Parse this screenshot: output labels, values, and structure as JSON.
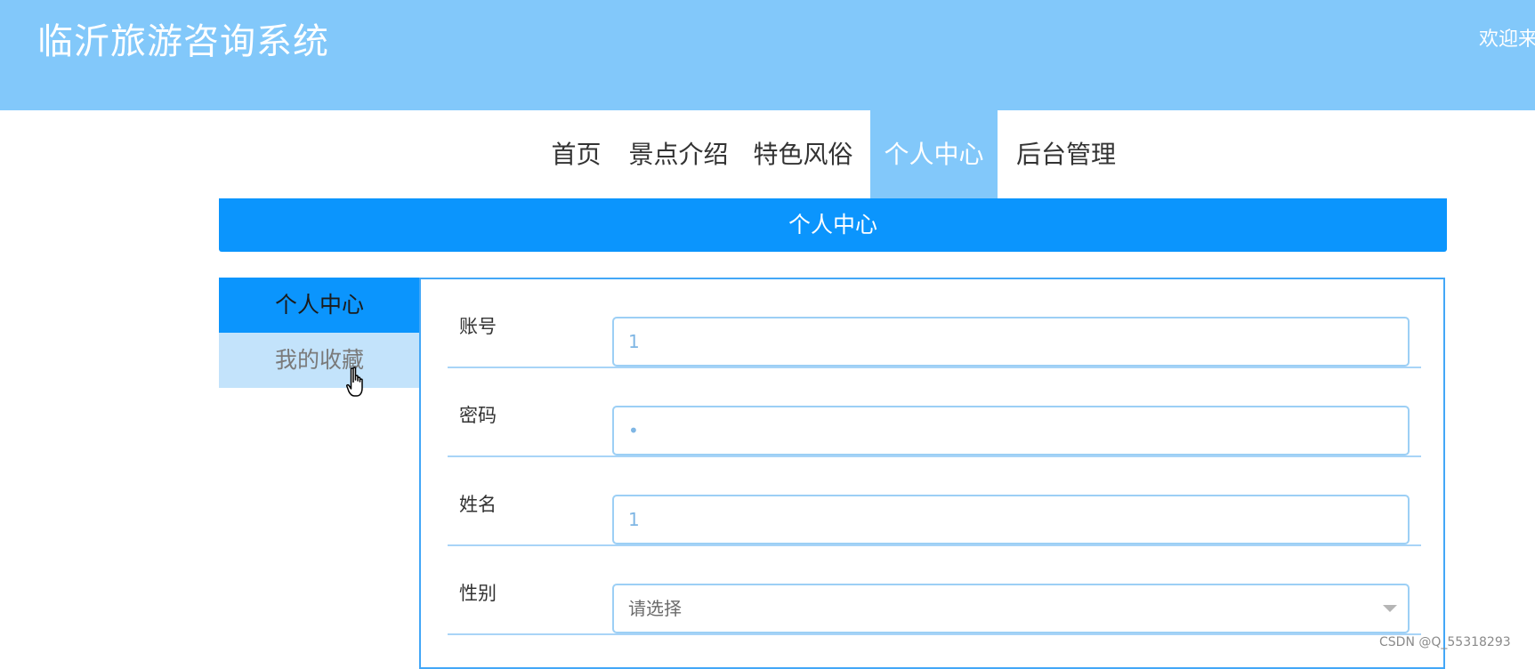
{
  "header": {
    "title": "临沂旅游咨询系统",
    "welcome": "欢迎来"
  },
  "nav": {
    "items": [
      {
        "label": "首页"
      },
      {
        "label": "景点介绍"
      },
      {
        "label": "特色风俗"
      },
      {
        "label": "个人中心",
        "active": true
      },
      {
        "label": "后台管理"
      }
    ]
  },
  "banner": {
    "title": "个人中心"
  },
  "side_menu": {
    "items": [
      {
        "label": "个人中心",
        "state": "active"
      },
      {
        "label": "我的收藏",
        "state": "hover"
      }
    ]
  },
  "form": {
    "account": {
      "label": "账号",
      "value": "1"
    },
    "password": {
      "label": "密码",
      "value": "1"
    },
    "name": {
      "label": "姓名",
      "value": "1"
    },
    "gender": {
      "label": "性别",
      "placeholder": "请选择"
    }
  },
  "watermark": "CSDN @Q_55318293",
  "colors": {
    "header_bg": "#82c8fa",
    "accent": "#0b95fd",
    "side_hover": "#c3e3fb",
    "panel_border": "#43a7f7"
  },
  "icons": {
    "cursor": "hand-pointer-icon",
    "select_caret": "caret-down-icon"
  }
}
